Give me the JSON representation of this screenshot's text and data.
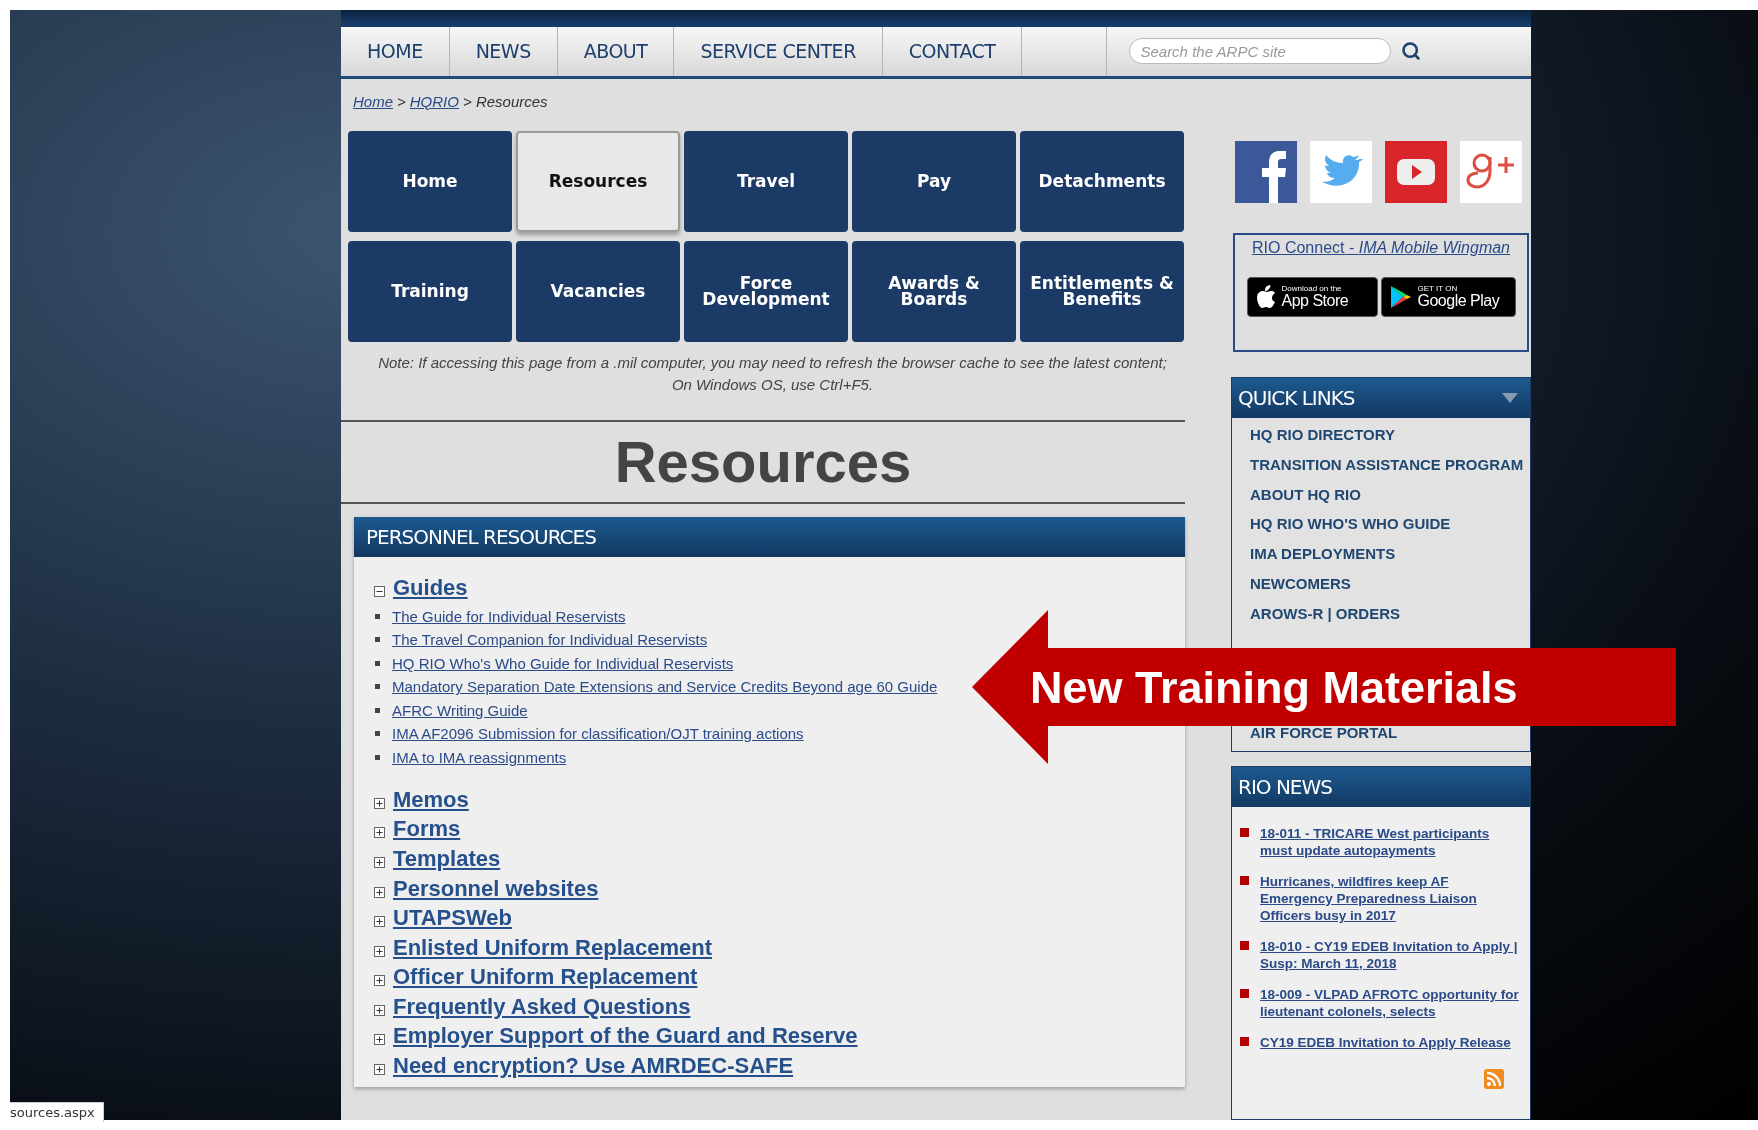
{
  "nav": {
    "items": [
      {
        "label": "HOME"
      },
      {
        "label": "NEWS"
      },
      {
        "label": "ABOUT"
      },
      {
        "label": "SERVICE CENTER"
      },
      {
        "label": "CONTACT"
      }
    ]
  },
  "search": {
    "placeholder": "Search the ARPC site"
  },
  "breadcrumb": [
    {
      "label": "Home",
      "link": true
    },
    {
      "label": ">",
      "link": false
    },
    {
      "label": "HQRIO",
      "link": true
    },
    {
      "label": "> Resources",
      "link": false
    }
  ],
  "tiles": [
    {
      "label": "Home",
      "selected": false
    },
    {
      "label": "Resources",
      "selected": true
    },
    {
      "label": "Travel",
      "selected": false
    },
    {
      "label": "Pay",
      "selected": false
    },
    {
      "label": "Detachments",
      "selected": false
    },
    {
      "label": "Training",
      "selected": false
    },
    {
      "label": "Vacancies",
      "selected": false
    },
    {
      "label": "Force Development",
      "selected": false
    },
    {
      "label": "Awards & Boards",
      "selected": false
    },
    {
      "label": "Entitlements & Benefits",
      "selected": false
    }
  ],
  "note": "Note: If accessing this page from a .mil computer, you may need to refresh the browser cache to see the latest content; On Windows OS, use Ctrl+F5.",
  "heading": "Resources",
  "panel": {
    "title": "PERSONNEL RESOURCES",
    "sections": [
      {
        "title": "Guides",
        "expanded": true,
        "links": [
          "The Guide for Individual Reservists",
          "The Travel Companion for Individual Reservists",
          "HQ RIO Who's Who Guide for Individual Reservists",
          "Mandatory Separation Date Extensions and Service Credits Beyond age 60 Guide",
          "AFRC Writing Guide",
          "IMA AF2096 Submission for classification/OJT training actions",
          "IMA to IMA reassignments"
        ]
      },
      {
        "title": "Memos",
        "expanded": false
      },
      {
        "title": "Forms",
        "expanded": false
      },
      {
        "title": "Templates",
        "expanded": false
      },
      {
        "title": "Personnel websites",
        "expanded": false
      },
      {
        "title": "UTAPSWeb",
        "expanded": false
      },
      {
        "title": "Enlisted Uniform Replacement",
        "expanded": false
      },
      {
        "title": "Officer Uniform Replacement",
        "expanded": false
      },
      {
        "title": "Frequently Asked Questions",
        "expanded": false
      },
      {
        "title": "Employer Support of the Guard and Reserve",
        "expanded": false
      },
      {
        "title": "Need encryption? Use AMRDEC-SAFE",
        "expanded": false
      }
    ]
  },
  "rio_connect": {
    "title": "RIO Connect - *IMA Mobile Wingman*",
    "app_store": {
      "small": "Download on the",
      "big": "App Store"
    },
    "google_play": {
      "small": "GET IT ON",
      "big": "Google Play"
    }
  },
  "quick_links": {
    "title": "QUICK LINKS",
    "items": [
      "HQ RIO DIRECTORY",
      "TRANSITION ASSISTANCE PROGRAM",
      "ABOUT HQ RIO",
      "HQ RIO WHO'S WHO GUIDE",
      "IMA DEPLOYMENTS",
      "NEWCOMERS",
      "AROWS-R | ORDERS",
      "AIR FORCE PORTAL"
    ]
  },
  "news": {
    "title": "RIO NEWS",
    "items": [
      "18-011 - TRICARE West participants must update autopayments",
      "Hurricanes, wildfires keep AF Emergency Preparedness Liaison Officers busy in 2017",
      "18-010 - CY19 EDEB Invitation to Apply | Susp: March 11, 2018",
      "18-009 - VLPAD AFROTC opportunity for lieutenant colonels, selects",
      "CY19 EDEB Invitation to Apply Release"
    ]
  },
  "callout": "New Training Materials",
  "status_bar": "sources.aspx"
}
